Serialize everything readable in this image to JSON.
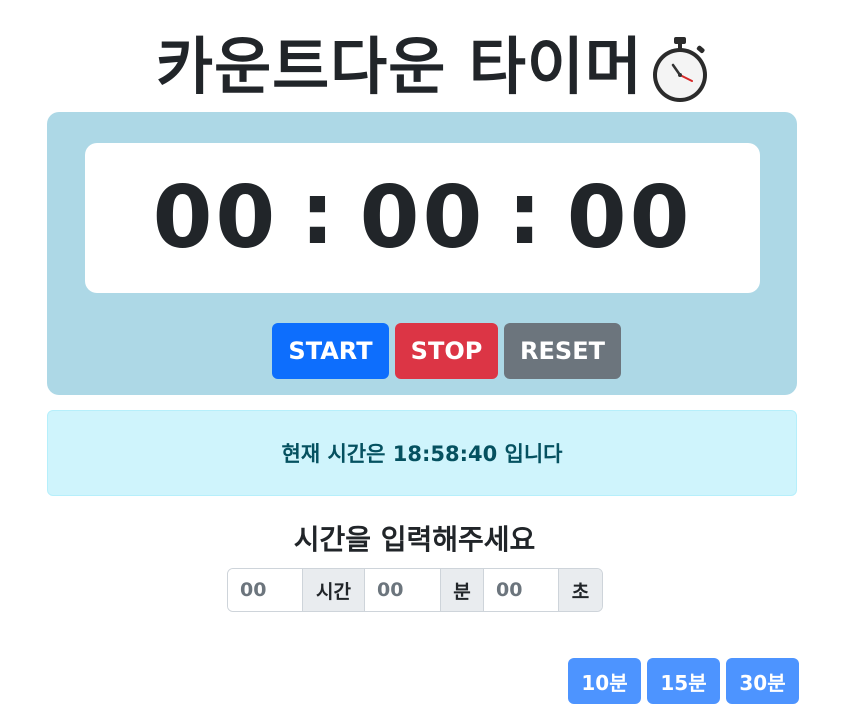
{
  "header": {
    "title": "카운트다운 타이머",
    "icon": "stopwatch-icon"
  },
  "timer": {
    "hours": "00",
    "minutes": "00",
    "seconds": "00",
    "separator": ":"
  },
  "controls": {
    "start_label": "START",
    "stop_label": "STOP",
    "reset_label": "RESET"
  },
  "clock": {
    "text": "현재 시간은 18:58:40 입니다"
  },
  "input_section": {
    "title": "시간을 입력해주세요",
    "hours_placeholder": "00",
    "hours_unit": "시간",
    "minutes_placeholder": "00",
    "minutes_unit": "분",
    "seconds_placeholder": "00",
    "seconds_unit": "초"
  },
  "presets": [
    {
      "label": "10분"
    },
    {
      "label": "15분"
    },
    {
      "label": "30분"
    }
  ],
  "colors": {
    "panel_bg": "#add8e6",
    "start": "#0d6efd",
    "stop": "#dc3545",
    "reset": "#6c757d",
    "info_bg": "#cff4fc",
    "info_text": "#055160",
    "preset": "#4d94ff"
  }
}
